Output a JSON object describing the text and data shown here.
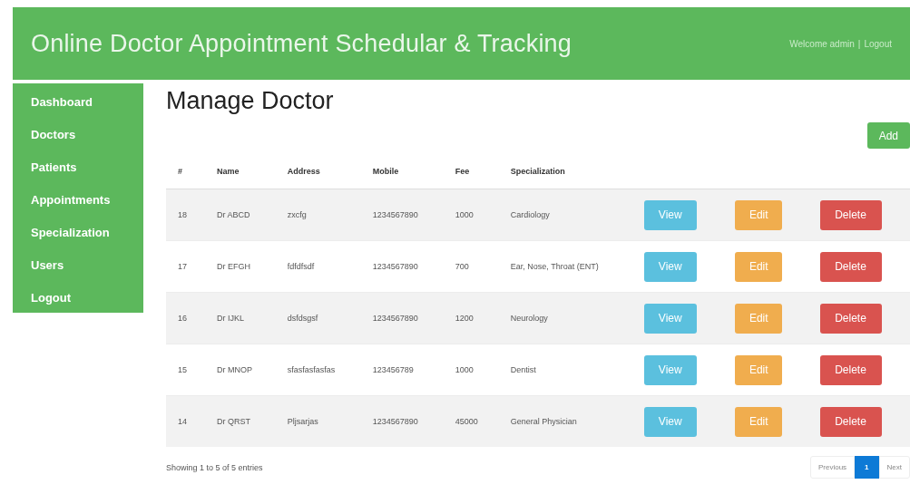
{
  "header": {
    "title": "Online Doctor Appointment Schedular & Tracking",
    "user": "Welcome admin",
    "separator": "|",
    "logout": "Logout"
  },
  "sidebar": {
    "items": [
      {
        "label": "Dashboard"
      },
      {
        "label": "Doctors"
      },
      {
        "label": "Patients"
      },
      {
        "label": "Appointments"
      },
      {
        "label": "Specialization"
      },
      {
        "label": "Users"
      },
      {
        "label": "Logout"
      }
    ]
  },
  "page": {
    "title": "Manage Doctor",
    "add_button": "Add"
  },
  "table": {
    "columns": [
      "#",
      "Name",
      "Address",
      "Mobile",
      "Fee",
      "Specialization"
    ],
    "rows": [
      {
        "cells": [
          "18",
          "Dr ABCD",
          "zxcfg",
          "1234567890",
          "1000",
          "Cardiology"
        ],
        "actions": [
          "View",
          "Edit",
          "Delete"
        ]
      },
      {
        "cells": [
          "17",
          "Dr EFGH",
          "fdfdfsdf",
          "1234567890",
          "700",
          "Ear, Nose, Throat (ENT)"
        ],
        "actions": [
          "View",
          "Edit",
          "Delete"
        ]
      },
      {
        "cells": [
          "16",
          "Dr IJKL",
          "dsfdsgsf",
          "1234567890",
          "1200",
          "Neurology"
        ],
        "actions": [
          "View",
          "Edit",
          "Delete"
        ]
      },
      {
        "cells": [
          "15",
          "Dr MNOP",
          "sfasfasfasfas",
          "123456789",
          "1000",
          "Dentist"
        ],
        "actions": [
          "View",
          "Edit",
          "Delete"
        ]
      },
      {
        "cells": [
          "14",
          "Dr QRST",
          "Pljsarjas",
          "1234567890",
          "45000",
          "General Physician"
        ],
        "actions": [
          "View",
          "Edit",
          "Delete"
        ]
      }
    ]
  },
  "footer": {
    "info": "Showing 1 to 5 of 5 entries",
    "pagination": [
      {
        "label": "Previous",
        "kind": "prev",
        "selected": false
      },
      {
        "label": "1",
        "kind": "page",
        "selected": true
      },
      {
        "label": "Next",
        "kind": "next",
        "selected": false
      }
    ]
  }
}
